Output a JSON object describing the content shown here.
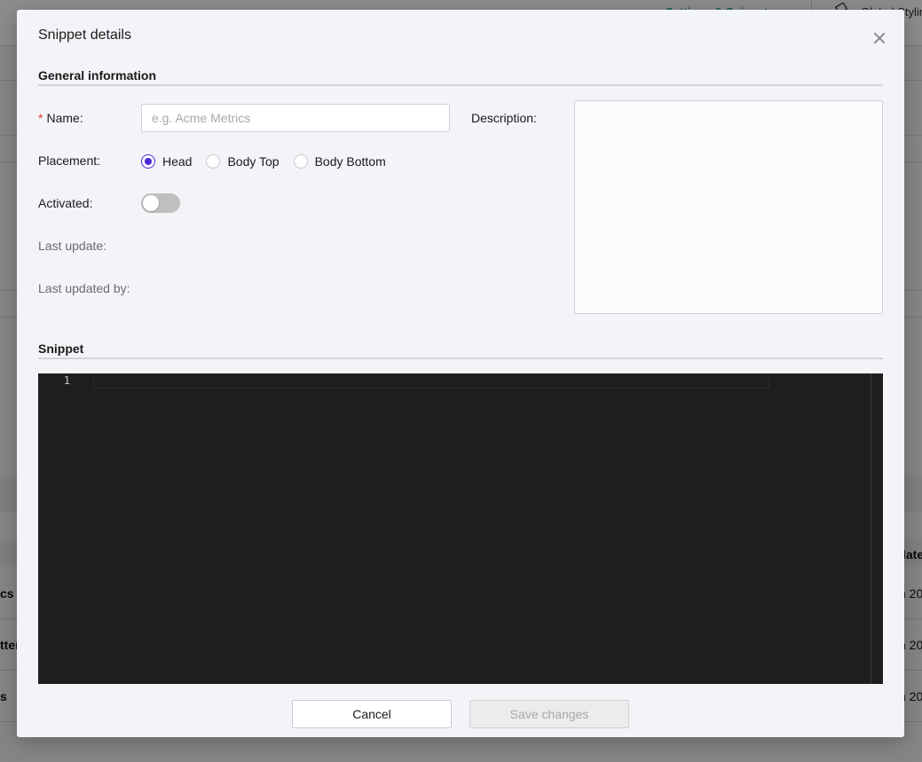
{
  "background": {
    "nav_link": "Settings & Snippets",
    "nav_link_chevron": "⌄",
    "global_styling": "Global Styling",
    "table_header_partial": "late",
    "rows": [
      {
        "name_partial": "cs",
        "date_partial": "h 20"
      },
      {
        "name_partial": "tter",
        "date_partial": "h 20"
      },
      {
        "name_partial": "s",
        "date_partial": "h 20"
      }
    ]
  },
  "modal": {
    "title": "Snippet details",
    "close_icon": "close-icon"
  },
  "general": {
    "section_title": "General information",
    "name_label": "Name",
    "required_mark": "*",
    "name_placeholder": "e.g. Acme Metrics",
    "name_value": "",
    "description_label": "Description",
    "description_value": "",
    "placement_label": "Placement",
    "placement_options": [
      {
        "label": "Head",
        "selected": true
      },
      {
        "label": "Body Top",
        "selected": false
      },
      {
        "label": "Body Bottom",
        "selected": false
      }
    ],
    "activated_label": "Activated",
    "activated": false,
    "last_update_label": "Last update",
    "last_updated_by_label": "Last updated by",
    "colon": ":"
  },
  "snippet": {
    "section_title": "Snippet",
    "line_numbers": [
      "1"
    ],
    "code": ""
  },
  "footer": {
    "cancel_label": "Cancel",
    "save_label": "Save changes",
    "save_disabled": true
  },
  "colors": {
    "accent": "#4b28d6",
    "required": "#e0312f",
    "editor_bg": "#1e1e1e",
    "nav_link": "#18a57a"
  }
}
